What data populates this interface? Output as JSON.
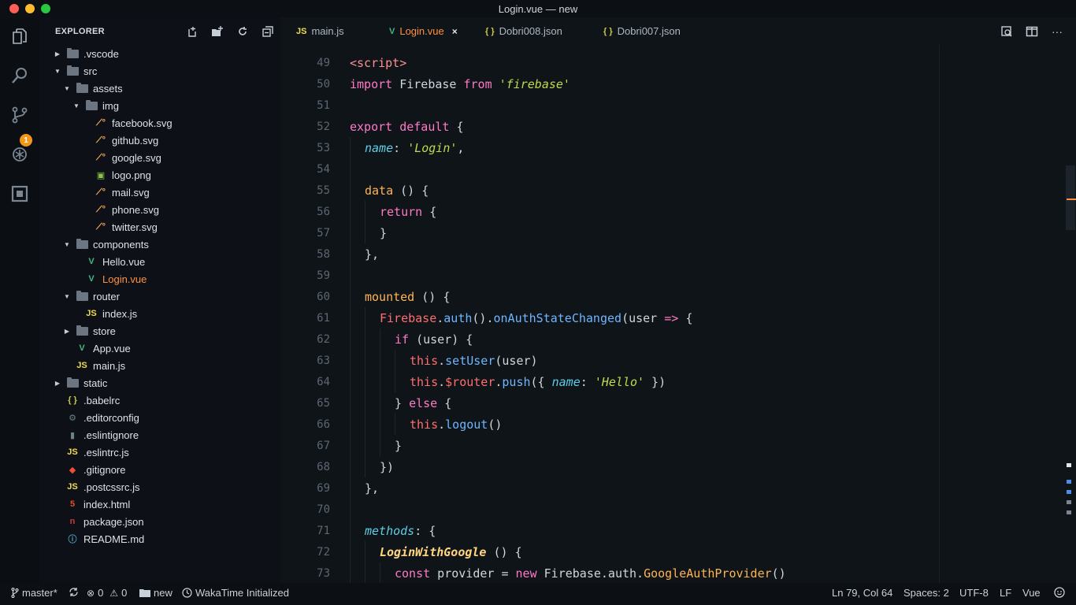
{
  "window": {
    "title": "Login.vue — new"
  },
  "sidebar": {
    "header": "EXPLORER",
    "tree": [
      {
        "label": ".vscode",
        "kind": "folder",
        "depth": 0,
        "expanded": false
      },
      {
        "label": "src",
        "kind": "folder",
        "depth": 0,
        "expanded": true
      },
      {
        "label": "assets",
        "kind": "folder",
        "depth": 1,
        "expanded": true
      },
      {
        "label": "img",
        "kind": "folder",
        "depth": 2,
        "expanded": true
      },
      {
        "label": "facebook.svg",
        "kind": "svg",
        "depth": 3
      },
      {
        "label": "github.svg",
        "kind": "svg",
        "depth": 3
      },
      {
        "label": "google.svg",
        "kind": "svg",
        "depth": 3
      },
      {
        "label": "logo.png",
        "kind": "png",
        "depth": 3
      },
      {
        "label": "mail.svg",
        "kind": "svg",
        "depth": 3
      },
      {
        "label": "phone.svg",
        "kind": "svg",
        "depth": 3
      },
      {
        "label": "twitter.svg",
        "kind": "svg",
        "depth": 3
      },
      {
        "label": "components",
        "kind": "folder",
        "depth": 1,
        "expanded": true
      },
      {
        "label": "Hello.vue",
        "kind": "vue",
        "depth": 2
      },
      {
        "label": "Login.vue",
        "kind": "vue",
        "depth": 2,
        "active": true
      },
      {
        "label": "router",
        "kind": "folder",
        "depth": 1,
        "expanded": true
      },
      {
        "label": "index.js",
        "kind": "js",
        "depth": 2
      },
      {
        "label": "store",
        "kind": "folder",
        "depth": 1,
        "expanded": false
      },
      {
        "label": "App.vue",
        "kind": "vue",
        "depth": 1
      },
      {
        "label": "main.js",
        "kind": "js",
        "depth": 1
      },
      {
        "label": "static",
        "kind": "folder",
        "depth": 0,
        "expanded": false
      },
      {
        "label": ".babelrc",
        "kind": "json",
        "depth": 0
      },
      {
        "label": ".editorconfig",
        "kind": "gear",
        "depth": 0
      },
      {
        "label": ".eslintignore",
        "kind": "file",
        "depth": 0
      },
      {
        "label": ".eslintrc.js",
        "kind": "js",
        "depth": 0
      },
      {
        "label": ".gitignore",
        "kind": "git",
        "depth": 0
      },
      {
        "label": ".postcssrc.js",
        "kind": "js",
        "depth": 0
      },
      {
        "label": "index.html",
        "kind": "html",
        "depth": 0
      },
      {
        "label": "package.json",
        "kind": "npm",
        "depth": 0
      },
      {
        "label": "README.md",
        "kind": "info",
        "depth": 0
      }
    ]
  },
  "activity": {
    "scm_badge": "1"
  },
  "tabs": [
    {
      "label": "main.js",
      "kind": "js",
      "active": false
    },
    {
      "label": "Login.vue",
      "kind": "vue",
      "active": true,
      "close": "×"
    },
    {
      "label": "Dobri008.json",
      "kind": "json",
      "active": false
    },
    {
      "label": "Dobri007.json",
      "kind": "json",
      "active": false
    }
  ],
  "icons": {
    "js": "JS",
    "json": "{ }",
    "vue": "V"
  },
  "editor": {
    "first_line": 49,
    "lines": [
      {
        "n": "49",
        "indent": 0,
        "tokens": [
          [
            "tag",
            "<script>"
          ]
        ]
      },
      {
        "n": "50",
        "indent": 0,
        "tokens": [
          [
            "kw2",
            "import"
          ],
          [
            "",
            " Firebase "
          ],
          [
            "kw2",
            "from"
          ],
          [
            "",
            " "
          ],
          [
            "str",
            "'firebase'"
          ]
        ]
      },
      {
        "n": "51",
        "indent": 0,
        "tokens": []
      },
      {
        "n": "52",
        "indent": 0,
        "tokens": [
          [
            "kw2",
            "export"
          ],
          [
            "",
            " "
          ],
          [
            "kw2",
            "default"
          ],
          [
            "",
            " {"
          ]
        ]
      },
      {
        "n": "53",
        "indent": 1,
        "tokens": [
          [
            "prop",
            "name"
          ],
          [
            "",
            ": "
          ],
          [
            "str",
            "'Login'"
          ],
          [
            "",
            ","
          ]
        ]
      },
      {
        "n": "54",
        "indent": 1,
        "tokens": []
      },
      {
        "n": "55",
        "indent": 1,
        "tokens": [
          [
            "fn",
            "data"
          ],
          [
            "",
            " () {"
          ]
        ]
      },
      {
        "n": "56",
        "indent": 2,
        "tokens": [
          [
            "kw2",
            "return"
          ],
          [
            "",
            " {"
          ]
        ]
      },
      {
        "n": "57",
        "indent": 2,
        "tokens": [
          [
            "",
            "}"
          ]
        ]
      },
      {
        "n": "58",
        "indent": 1,
        "tokens": [
          [
            "",
            "},"
          ]
        ]
      },
      {
        "n": "59",
        "indent": 1,
        "tokens": []
      },
      {
        "n": "60",
        "indent": 1,
        "tokens": [
          [
            "fn",
            "mounted"
          ],
          [
            "",
            " () {"
          ]
        ]
      },
      {
        "n": "61",
        "indent": 2,
        "tokens": [
          [
            "obj",
            "Firebase"
          ],
          [
            "",
            "."
          ],
          [
            "meth",
            "auth"
          ],
          [
            "",
            "()."
          ],
          [
            "meth",
            "onAuthStateChanged"
          ],
          [
            "",
            "(user "
          ],
          [
            "kw2",
            "=>"
          ],
          [
            "",
            " {"
          ]
        ]
      },
      {
        "n": "62",
        "indent": 3,
        "tokens": [
          [
            "kw2",
            "if"
          ],
          [
            "",
            " (user) {"
          ]
        ]
      },
      {
        "n": "63",
        "indent": 4,
        "tokens": [
          [
            "obj",
            "this"
          ],
          [
            "",
            "."
          ],
          [
            "meth",
            "setUser"
          ],
          [
            "",
            "(user)"
          ]
        ]
      },
      {
        "n": "64",
        "indent": 4,
        "tokens": [
          [
            "obj",
            "this"
          ],
          [
            "",
            "."
          ],
          [
            "obj",
            "$router"
          ],
          [
            "",
            "."
          ],
          [
            "meth",
            "push"
          ],
          [
            "",
            "({ "
          ],
          [
            "prop",
            "name"
          ],
          [
            "",
            ": "
          ],
          [
            "str",
            "'Hello'"
          ],
          [
            "",
            " })"
          ]
        ]
      },
      {
        "n": "65",
        "indent": 3,
        "tokens": [
          [
            "",
            "} "
          ],
          [
            "kw2",
            "else"
          ],
          [
            "",
            " {"
          ]
        ]
      },
      {
        "n": "66",
        "indent": 4,
        "tokens": [
          [
            "obj",
            "this"
          ],
          [
            "",
            "."
          ],
          [
            "meth",
            "logout"
          ],
          [
            "",
            "()"
          ]
        ]
      },
      {
        "n": "67",
        "indent": 3,
        "tokens": [
          [
            "",
            "}"
          ]
        ]
      },
      {
        "n": "68",
        "indent": 2,
        "tokens": [
          [
            "",
            "})"
          ]
        ]
      },
      {
        "n": "69",
        "indent": 1,
        "tokens": [
          [
            "",
            "},"
          ]
        ]
      },
      {
        "n": "70",
        "indent": 1,
        "tokens": []
      },
      {
        "n": "71",
        "indent": 1,
        "tokens": [
          [
            "prop",
            "methods"
          ],
          [
            "",
            ": {"
          ]
        ]
      },
      {
        "n": "72",
        "indent": 2,
        "tokens": [
          [
            "bright",
            "LoginWithGoogle"
          ],
          [
            "",
            " () {"
          ]
        ]
      },
      {
        "n": "73",
        "indent": 3,
        "tokens": [
          [
            "kw2",
            "const"
          ],
          [
            "",
            " provider = "
          ],
          [
            "kw2",
            "new"
          ],
          [
            "",
            " Firebase.auth."
          ],
          [
            "fn",
            "GoogleAuthProvider"
          ],
          [
            "",
            "()"
          ]
        ]
      }
    ]
  },
  "status": {
    "branch": "master*",
    "errors": "0",
    "warnings": "0",
    "folder": "new",
    "wakatime": "WakaTime Initialized",
    "position": "Ln 79, Col 64",
    "spaces": "Spaces: 2",
    "encoding": "UTF-8",
    "eol": "LF",
    "language": "Vue"
  },
  "colors": {
    "accent": "#ff8f40",
    "vue": "#41b883",
    "js": "#f0db4f",
    "json": "#cbcb41"
  }
}
